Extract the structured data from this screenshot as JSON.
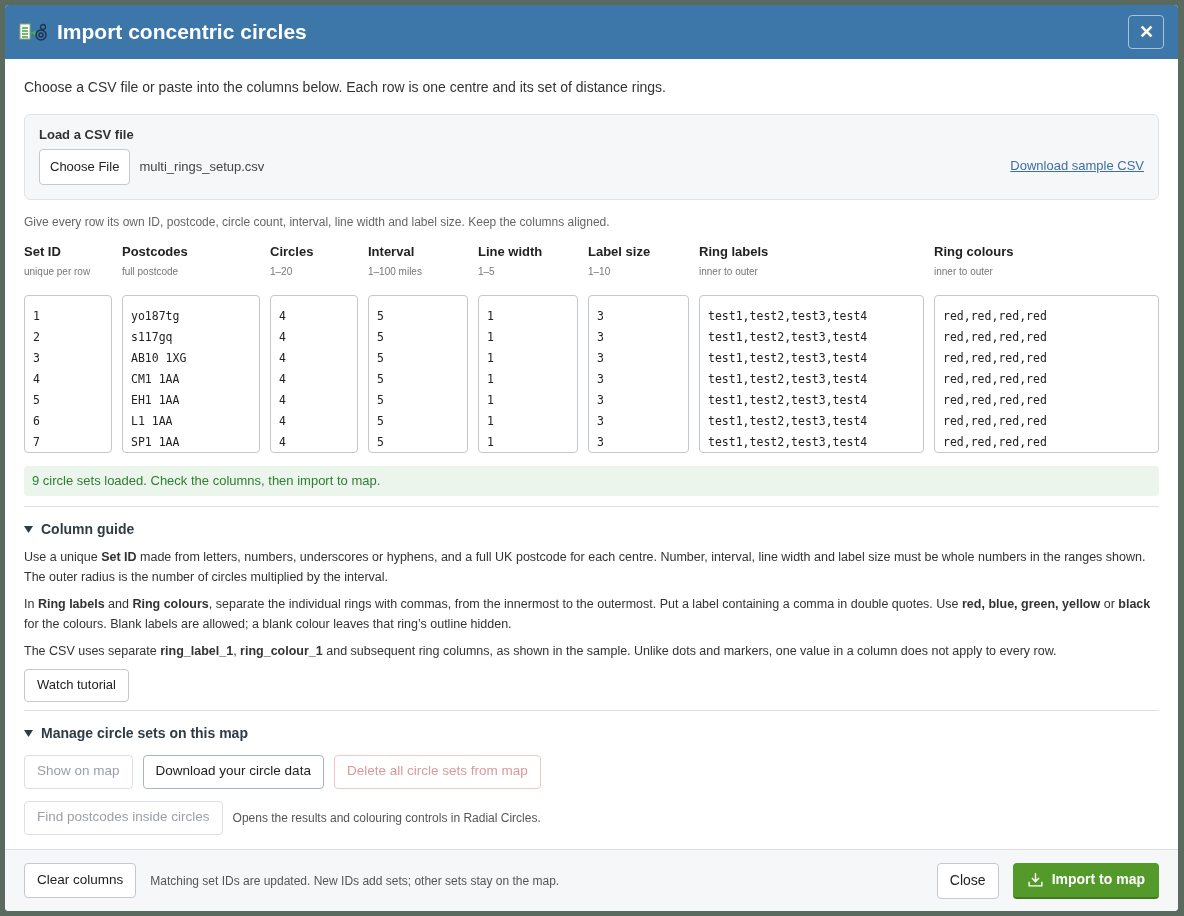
{
  "dialog": {
    "title": "Import concentric circles",
    "close_symbol": "✕"
  },
  "intro": "Choose a CSV file or paste into the columns below. Each row is one centre and its set of distance rings.",
  "file_panel": {
    "heading": "Load a CSV file",
    "button": "Choose File",
    "file_name": "multi_rings_setup.csv",
    "link": "Download sample CSV"
  },
  "columns_hint": "Give every row its own ID, postcode, circle count, interval, line width and label size. Keep the columns aligned.",
  "columns": [
    {
      "header": "Set ID",
      "hint": "unique per row",
      "lines": [
        "1",
        "2",
        "3",
        "4",
        "5",
        "6",
        "7"
      ]
    },
    {
      "header": "Postcodes",
      "hint": "full postcode",
      "lines": [
        "yo187tg",
        "s117gq",
        "AB10 1XG",
        "CM1 1AA",
        "EH1 1AA",
        "L1 1AA",
        "SP1 1AA"
      ]
    },
    {
      "header": "Circles",
      "hint": "1–20",
      "lines": [
        "4",
        "4",
        "4",
        "4",
        "4",
        "4",
        "4"
      ]
    },
    {
      "header": "Interval",
      "hint": "1–100 miles",
      "lines": [
        "5",
        "5",
        "5",
        "5",
        "5",
        "5",
        "5"
      ]
    },
    {
      "header": "Line width",
      "hint": "1–5",
      "lines": [
        "1",
        "1",
        "1",
        "1",
        "1",
        "1",
        "1"
      ]
    },
    {
      "header": "Label size",
      "hint": "1–10",
      "lines": [
        "3",
        "3",
        "3",
        "3",
        "3",
        "3",
        "3"
      ]
    },
    {
      "header": "Ring labels",
      "hint": "inner to outer",
      "lines": [
        "test1,test2,test3,test4",
        "test1,test2,test3,test4",
        "test1,test2,test3,test4",
        "test1,test2,test3,test4",
        "test1,test2,test3,test4",
        "test1,test2,test3,test4",
        "test1,test2,test3,test4"
      ]
    },
    {
      "header": "Ring colours",
      "hint": "inner to outer",
      "lines": [
        "red,red,red,red",
        "red,red,red,red",
        "red,red,red,red",
        "red,red,red,red",
        "red,red,red,red",
        "red,red,red,red",
        "red,red,red,red"
      ]
    }
  ],
  "status_message": "9 circle sets loaded. Check the columns, then import to map.",
  "column_guide": {
    "title": "Column guide",
    "expanded": true,
    "paragraphs": [
      "Use a unique **Set ID** made from letters, numbers, underscores or hyphens, and a full UK postcode for each centre. Number, interval, line width and label size must be whole numbers in the ranges shown. The outer radius is the number of circles multiplied by the interval.",
      "In **Ring labels** and **Ring colours**, separate the individual rings with commas, from the innermost to the outermost. Put a label containing a comma in double quotes. Use **red, blue, green, yellow** or **black** for the colours. Blank labels are allowed; a blank colour leaves that ring’s outline hidden.",
      "The CSV uses separate **ring_label_1**, **ring_colour_1** and subsequent ring columns, as shown in the sample. Unlike dots and markers, one value in a column does not apply to every row."
    ],
    "button": "Watch tutorial"
  },
  "manage": {
    "title": "Manage circle sets on this map",
    "expanded": true,
    "buttons": [
      {
        "label": "Show on map",
        "kind": "default",
        "disabled": true
      },
      {
        "label": "Download your circle data",
        "kind": "default",
        "disabled": false
      },
      {
        "label": "Delete all circle sets from map",
        "kind": "danger",
        "disabled": true
      }
    ],
    "find_button": {
      "label": "Find postcodes inside circles",
      "disabled": true
    },
    "find_note": "Opens the results and colouring controls in Radial Circles."
  },
  "footer": {
    "clear_button": "Clear columns",
    "note": "Matching set IDs are updated. New IDs add sets; other sets stay on the map.",
    "close_button": "Close",
    "import_button": "Import to map"
  }
}
